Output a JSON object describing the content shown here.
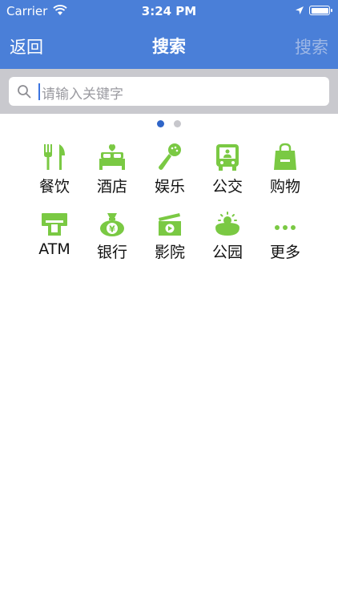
{
  "status_bar": {
    "carrier": "Carrier",
    "time": "3:24 PM"
  },
  "nav": {
    "back_label": "返回",
    "title": "搜索",
    "search_label": "搜索"
  },
  "search": {
    "placeholder": "请输入关键字"
  },
  "pager": {
    "pages": 2,
    "current": 1
  },
  "colors": {
    "nav_bg": "#4a7fd8",
    "icon_green": "#7ac943",
    "search_disabled": "#9fb8e6"
  },
  "categories": [
    {
      "label": "餐饮",
      "icon": "fork-knife-icon"
    },
    {
      "label": "酒店",
      "icon": "hotel-bed-icon"
    },
    {
      "label": "娱乐",
      "icon": "microphone-icon"
    },
    {
      "label": "公交",
      "icon": "bus-icon"
    },
    {
      "label": "购物",
      "icon": "shopping-bag-icon"
    },
    {
      "label": "ATM",
      "icon": "atm-icon"
    },
    {
      "label": "银行",
      "icon": "money-bag-icon"
    },
    {
      "label": "影院",
      "icon": "clapperboard-icon"
    },
    {
      "label": "公园",
      "icon": "park-sun-icon"
    },
    {
      "label": "更多",
      "icon": "more-dots-icon"
    }
  ]
}
